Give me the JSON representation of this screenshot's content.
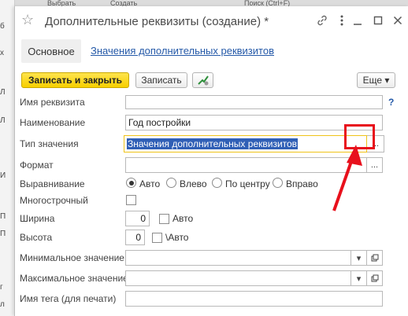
{
  "window": {
    "title": "Дополнительные реквизиты (создание)",
    "title_modified_marker": "*"
  },
  "tabs": {
    "main": "Основное",
    "values_link": "Значения дополнительных реквизитов"
  },
  "toolbar": {
    "save_close": "Записать и закрыть",
    "save": "Записать",
    "more": "Еще"
  },
  "form": {
    "name_label": "Имя реквизита",
    "name_value": "",
    "help": "?",
    "title_label": "Наименование",
    "title_value": "Год постройки",
    "type_label": "Тип значения",
    "type_value": "Значения дополнительных реквизитов",
    "format_label": "Формат",
    "format_value": "",
    "align_label": "Выравнивание",
    "align_options": [
      "Авто",
      "Влево",
      "По центру",
      "Вправо"
    ],
    "align_selected": "Авто",
    "multiline_label": "Многострочный",
    "width_label": "Ширина",
    "width_value": "0",
    "width_auto": "Авто",
    "height_label": "Высота",
    "height_value": "0",
    "height_auto": "\\Авто",
    "min_label": "Минимальное значение",
    "max_label": "Максимальное значение",
    "tag_label": "Имя тега (для печати)",
    "dots": "..."
  },
  "background": {
    "tab_a": "Выбрать",
    "tab_b": "Создать",
    "tab_c": "Поиск (Ctrl+F)",
    "left_items": [
      "б",
      "х",
      "Л",
      "Л",
      "И",
      "П",
      "П",
      "г",
      "л"
    ]
  }
}
